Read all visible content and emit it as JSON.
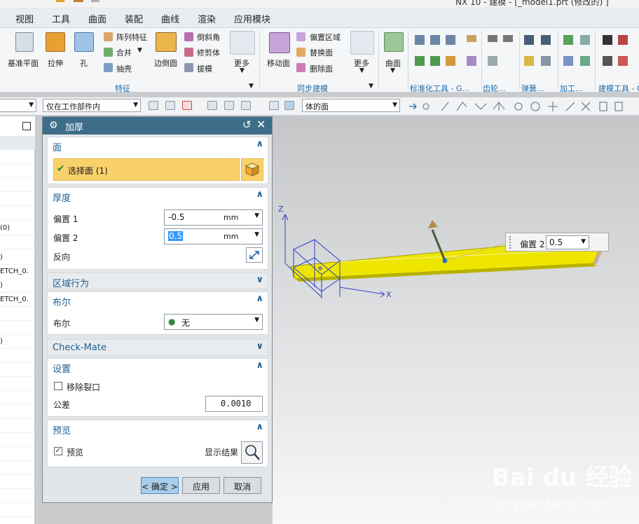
{
  "window": {
    "title": "NX 10 - 建模 - [_model1.prt  (修改的) ]"
  },
  "menu": [
    "视图",
    "工具",
    "曲面",
    "装配",
    "曲线",
    "渲染",
    "应用模块"
  ],
  "ribbon": {
    "feature_group": {
      "label": "特征",
      "big": [
        "基准平面",
        "拉伸",
        "孔",
        "边倒圆",
        "更多"
      ],
      "small": [
        "阵列特征",
        "合并",
        "抽壳",
        "倒斜角",
        "修剪体",
        "拔模"
      ]
    },
    "sync_group": {
      "label": "同步建模",
      "big": [
        "移动面",
        "更多"
      ],
      "small": [
        "偏置区域",
        "替换面",
        "删除面"
      ]
    },
    "surface_big": "曲面",
    "other_groups": [
      "标准化工具 - G...",
      "齿轮...",
      "弹簧...",
      "加工...",
      "建模工具 - G..."
    ]
  },
  "selbar": {
    "filter": "仅在工作部件内",
    "face_rule": "体的面"
  },
  "navigator": {
    "rows": [
      "(0)",
      ")",
      "ETCH_0.",
      ")",
      "ETCH_0.",
      ")"
    ]
  },
  "dialog": {
    "title": "加厚",
    "face": {
      "header": "面",
      "select_label": "选择面 (1)"
    },
    "thickness": {
      "header": "厚度",
      "offset1_label": "偏置 1",
      "offset1_value": "-0.5",
      "offset1_unit": "mm",
      "offset2_label": "偏置 2",
      "offset2_value": "0.5",
      "offset2_unit": "mm",
      "reverse_label": "反向"
    },
    "region": {
      "header": "区域行为"
    },
    "boolean": {
      "header": "布尔",
      "label": "布尔",
      "value": "无"
    },
    "checkmate": {
      "header": "Check-Mate"
    },
    "settings": {
      "header": "设置",
      "remove_crack_label": "移除裂口",
      "remove_crack_checked": false,
      "tolerance_label": "公差",
      "tolerance_value": "0.0010"
    },
    "preview": {
      "header": "预览",
      "preview_label": "预览",
      "preview_checked": true,
      "show_result_label": "显示结果"
    },
    "buttons": {
      "ok": "< 确定 >",
      "apply": "应用",
      "cancel": "取消"
    }
  },
  "viewport": {
    "axis_z": "Z",
    "axis_x": "X",
    "hint_label": "偏置 2",
    "hint_value": "0.5",
    "body_color": "#f5f000"
  },
  "watermark": {
    "logo": "Bai du 经验",
    "url": "jingyan.baidu.com"
  }
}
